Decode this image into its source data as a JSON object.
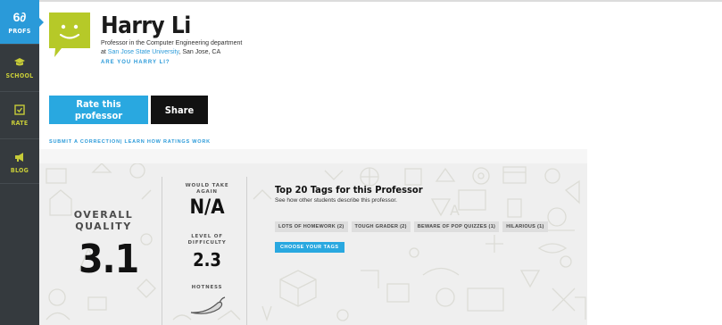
{
  "sidebar": {
    "items": [
      {
        "label": "PROFS",
        "icon": "glasses-icon"
      },
      {
        "label": "SCHOOL",
        "icon": "graduation-cap-icon"
      },
      {
        "label": "RATE",
        "icon": "checkbox-icon"
      },
      {
        "label": "BLOG",
        "icon": "megaphone-icon"
      }
    ],
    "profs_glyph": "6∂"
  },
  "professor": {
    "name": "Harry Li",
    "title_line": "Professor in the Computer Engineering department",
    "at_prefix": "at ",
    "school": "San Jose State University",
    "location": ", San Jose, CA",
    "claim": "ARE YOU HARRY LI?"
  },
  "actions": {
    "rate_label": "Rate this professor",
    "share_label": "Share"
  },
  "links": {
    "submit": "SUBMIT A CORRECTION",
    "separator": "|",
    "learn": "LEARN HOW RATINGS WORK"
  },
  "ratings": {
    "overall_label": "OVERALL QUALITY",
    "overall_value": "3.1",
    "would_take_again_label": "WOULD TAKE AGAIN",
    "would_take_again_value": "N/A",
    "difficulty_label": "LEVEL OF DIFFICULTY",
    "difficulty_value": "2.3",
    "hotness_label": "HOTNESS"
  },
  "tags": {
    "title": "Top 20 Tags for this Professor",
    "subtitle": "See how other students describe this professor.",
    "items": [
      "LOTS OF HOMEWORK (2)",
      "TOUGH GRADER (2)",
      "BEWARE OF POP QUIZZES (1)",
      "HILARIOUS (1)"
    ],
    "choose_label": "CHOOSE YOUR TAGS"
  },
  "colors": {
    "accent_blue": "#29a8e0",
    "avatar_green": "#b6c928",
    "sidebar_dark": "#353a3e",
    "sidebar_icon": "#c7cc38"
  }
}
